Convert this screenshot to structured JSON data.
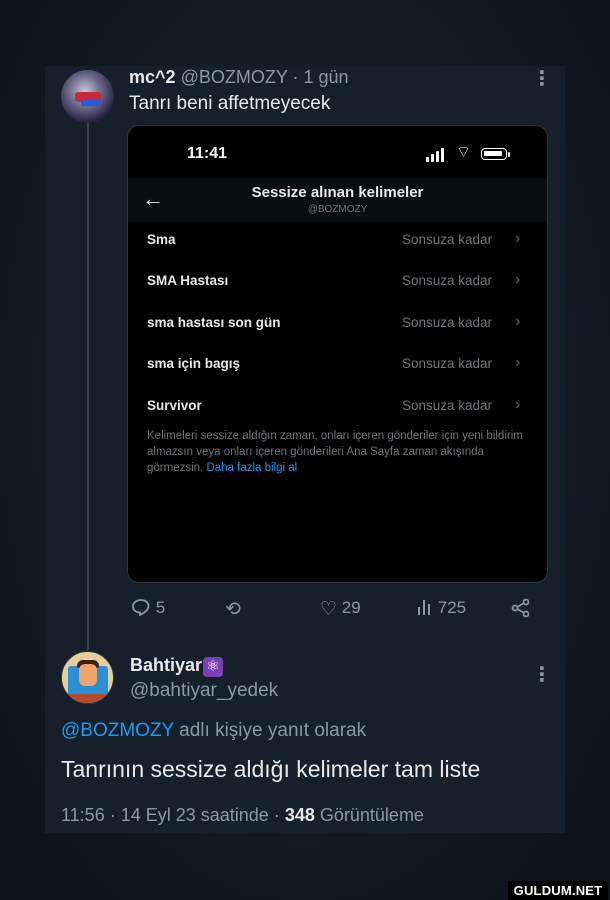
{
  "tweet1": {
    "display_name": "mc^2",
    "handle_time": "@BOZMOZY · 1 gün",
    "text": "Tanrı beni affetmeyecek",
    "more_icon": "more-dots-icon"
  },
  "screenshot": {
    "status_time": "11:41",
    "title": "Sessize alınan kelimeler",
    "subtitle": "@BOZMOZY",
    "rows": [
      {
        "word": "Sma",
        "duration": "Sonsuza kadar"
      },
      {
        "word": "SMA Hastası",
        "duration": "Sonsuza kadar"
      },
      {
        "word": "sma hastası son gün",
        "duration": "Sonsuza kadar"
      },
      {
        "word": "sma için bagış",
        "duration": "Sonsuza kadar"
      },
      {
        "word": "Survivor",
        "duration": "Sonsuza kadar"
      }
    ],
    "info_text": "Kelimeleri sessize aldığın zaman, onları içeren gönderiler için yeni bildirim almazsın veya onları içeren gönderileri Ana Sayfa zaman akışında görmezsin.",
    "info_link": "Daha fazla bilgi al"
  },
  "actions": {
    "replies": "5",
    "likes": "29",
    "views": "725"
  },
  "tweet2": {
    "display_name": "Bahtiyar",
    "badge": "⚛",
    "handle": "@bahtiyar_yedek",
    "reply_mention": "@BOZMOZY",
    "reply_suffix": "adlı kişiye yanıt olarak",
    "text": "Tanrının sessize aldığı kelimeler tam liste",
    "meta_prefix": "11:56 · 14 Eyl 23 saatinde ·",
    "views_count": "348",
    "views_label": "Görüntüleme"
  },
  "watermark": "GULDUM.NET",
  "colors": {
    "background": "#15202b",
    "accent": "#1d9bf0",
    "secondary_text": "#8b98a5"
  }
}
